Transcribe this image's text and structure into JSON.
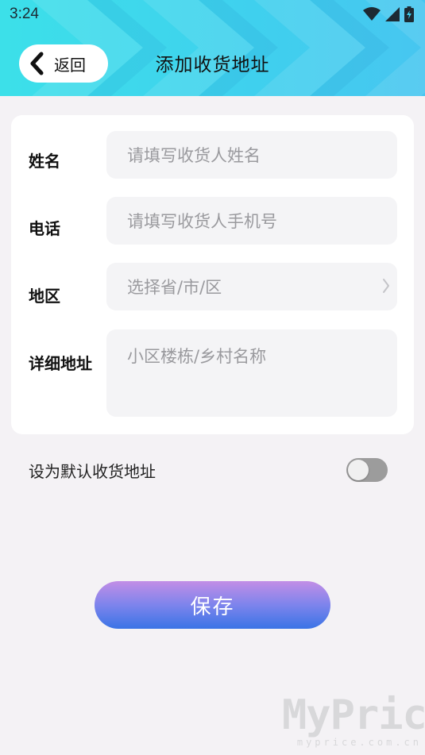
{
  "status_bar": {
    "time": "3:24",
    "icons": [
      "wifi-icon",
      "cellular-icon",
      "battery-charging-icon"
    ]
  },
  "header": {
    "back_label": "返回",
    "title": "添加收货地址",
    "gradient_colors": [
      "#3ce0e9",
      "#47c6f0"
    ]
  },
  "form": {
    "name": {
      "label": "姓名",
      "placeholder": "请填写收货人姓名"
    },
    "phone": {
      "label": "电话",
      "placeholder": "请填写收货人手机号"
    },
    "region": {
      "label": "地区",
      "placeholder": "选择省/市/区"
    },
    "address": {
      "label": "详细地址",
      "placeholder": "小区楼栋/乡村名称"
    }
  },
  "default_address": {
    "label": "设为默认收货地址",
    "enabled": false
  },
  "save_button": {
    "label": "保存",
    "gradient_colors": [
      "#c28ee6",
      "#3a74e6"
    ]
  },
  "watermark": {
    "brand": "MyPrice",
    "domain": "myprice.com.cn"
  }
}
